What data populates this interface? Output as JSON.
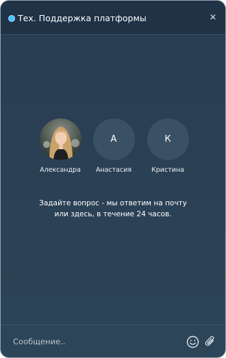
{
  "header": {
    "title": "Тех. Поддержка платформы",
    "close_label": "×",
    "status_color": "#4cc3ff"
  },
  "agents": [
    {
      "name": "Александра",
      "initial": "",
      "has_photo": true
    },
    {
      "name": "Анастасия",
      "initial": "А",
      "has_photo": false
    },
    {
      "name": "Кристина",
      "initial": "К",
      "has_photo": false
    }
  ],
  "message": {
    "line1": "Задайте вопрос - мы ответим на почту",
    "line2": "или здесь, в течение 24 часов."
  },
  "composer": {
    "placeholder": "Сообщение..",
    "emoji_icon": "smiley-icon",
    "attach_icon": "paperclip-icon"
  },
  "colors": {
    "background": "#2a3f54",
    "header": "#1f3246",
    "avatar_bg": "#3a5064"
  }
}
